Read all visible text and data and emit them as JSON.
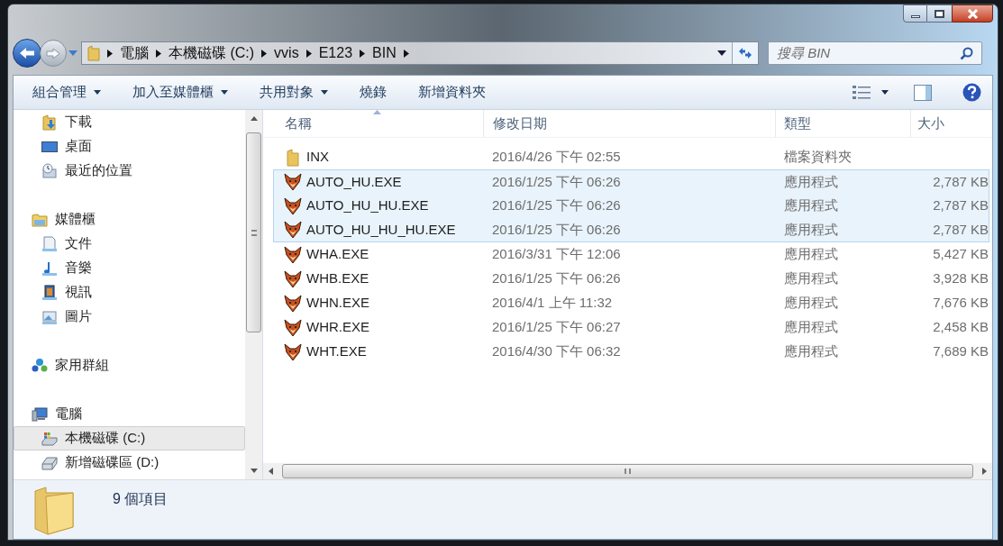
{
  "address_bar": {
    "crumbs": [
      "電腦",
      "本機磁碟 (C:)",
      "vvis",
      "E123",
      "BIN"
    ]
  },
  "search": {
    "placeholder": "搜尋 BIN"
  },
  "toolbar": {
    "buttons": [
      {
        "label": "組合管理",
        "dropdown": true
      },
      {
        "label": "加入至媒體櫃",
        "dropdown": true
      },
      {
        "label": "共用對象",
        "dropdown": true
      },
      {
        "label": "燒錄",
        "dropdown": false
      },
      {
        "label": "新增資料夾",
        "dropdown": false
      }
    ]
  },
  "navigation": {
    "groups": [
      {
        "children": [
          {
            "label": "下載",
            "kind": "downloads",
            "selected": false
          },
          {
            "label": "桌面",
            "kind": "desktop",
            "selected": false
          },
          {
            "label": "最近的位置",
            "kind": "recent",
            "selected": false
          }
        ]
      },
      {
        "label": "媒體櫃",
        "kind": "library",
        "selected": false,
        "children": [
          {
            "label": "文件",
            "kind": "documents",
            "selected": false
          },
          {
            "label": "音樂",
            "kind": "music",
            "selected": false
          },
          {
            "label": "視訊",
            "kind": "video",
            "selected": false
          },
          {
            "label": "圖片",
            "kind": "pictures",
            "selected": false
          }
        ]
      },
      {
        "label": "家用群組",
        "kind": "homegroup",
        "selected": false
      },
      {
        "label": "電腦",
        "kind": "computer",
        "selected": false,
        "children": [
          {
            "label": "本機磁碟 (C:)",
            "kind": "system-drive",
            "selected": true
          },
          {
            "label": "新增磁碟區 (D:)",
            "kind": "drive",
            "selected": false
          }
        ]
      }
    ]
  },
  "file_list": {
    "columns": [
      {
        "label": "名稱",
        "sorted": true
      },
      {
        "label": "修改日期",
        "sorted": false
      },
      {
        "label": "類型",
        "sorted": false
      },
      {
        "label": "大小",
        "sorted": false
      }
    ],
    "rows": [
      {
        "kind": "folder",
        "name": "INX",
        "modified": "2016/4/26 下午 02:55",
        "type": "檔案資料夾",
        "selected": false
      },
      {
        "kind": "exe",
        "name": "AUTO_HU.EXE",
        "modified": "2016/1/25 下午 06:26",
        "type": "應用程式",
        "size": "2,787 KB",
        "selected": true
      },
      {
        "kind": "exe",
        "name": "AUTO_HU_HU.EXE",
        "modified": "2016/1/25 下午 06:26",
        "type": "應用程式",
        "size": "2,787 KB",
        "selected": true
      },
      {
        "kind": "exe",
        "name": "AUTO_HU_HU_HU.EXE",
        "modified": "2016/1/25 下午 06:26",
        "type": "應用程式",
        "size": "2,787 KB",
        "selected": true
      },
      {
        "kind": "exe",
        "name": "WHA.EXE",
        "modified": "2016/3/31 下午 12:06",
        "type": "應用程式",
        "size": "5,427 KB",
        "selected": false
      },
      {
        "kind": "exe",
        "name": "WHB.EXE",
        "modified": "2016/1/25 下午 06:26",
        "type": "應用程式",
        "size": "3,928 KB",
        "selected": false
      },
      {
        "kind": "exe",
        "name": "WHN.EXE",
        "modified": "2016/4/1 上午 11:32",
        "type": "應用程式",
        "size": "7,676 KB",
        "selected": false
      },
      {
        "kind": "exe",
        "name": "WHR.EXE",
        "modified": "2016/1/25 下午 06:27",
        "type": "應用程式",
        "size": "2,458 KB",
        "selected": false
      },
      {
        "kind": "exe",
        "name": "WHT.EXE",
        "modified": "2016/4/30 下午 06:32",
        "type": "應用程式",
        "size": "7,689 KB",
        "selected": false
      }
    ]
  },
  "details_pane": {
    "item_count": "9 個項目"
  }
}
